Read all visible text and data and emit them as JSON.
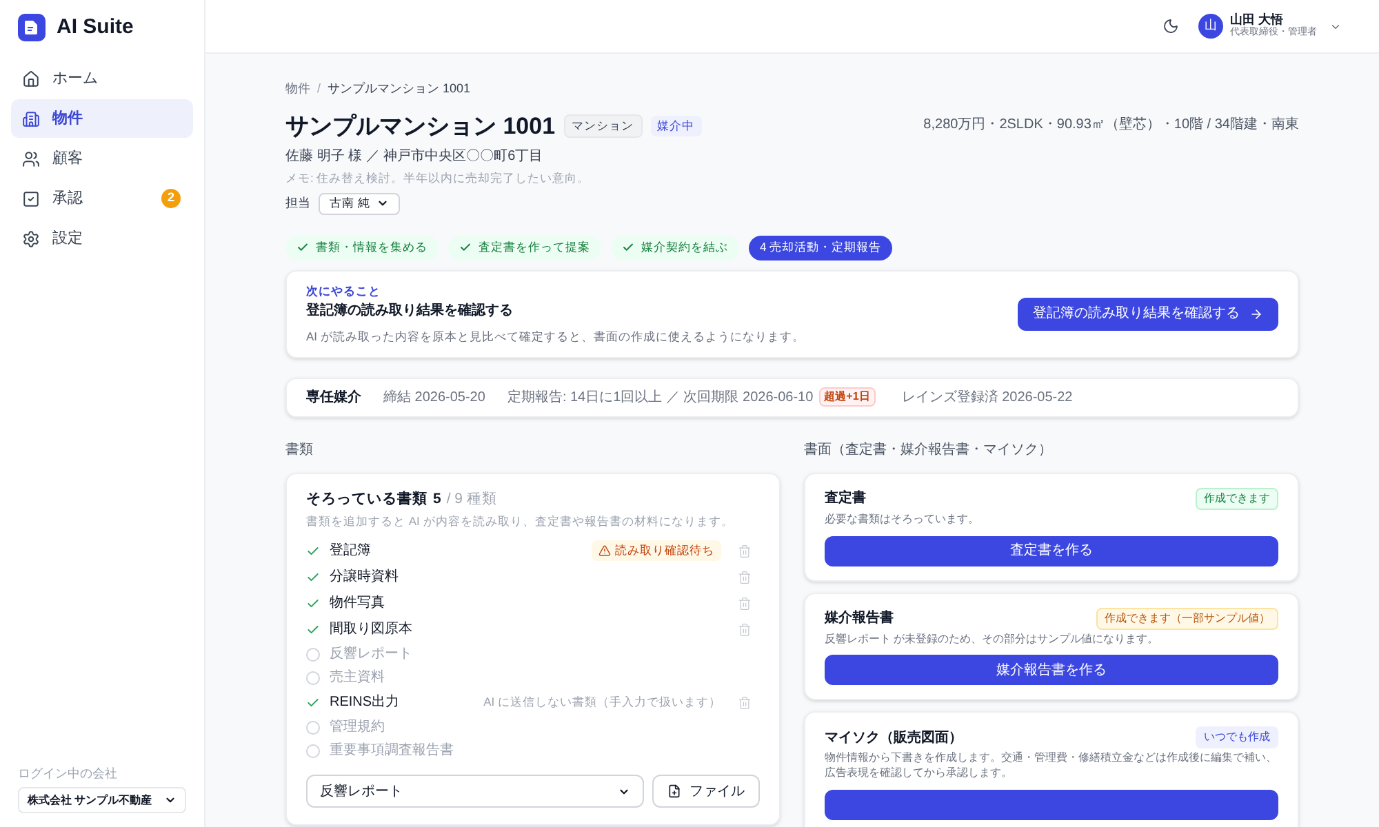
{
  "app": {
    "name": "AI Suite"
  },
  "sidebar": {
    "items": [
      {
        "label": "ホーム",
        "selected": false
      },
      {
        "label": "物件",
        "selected": true
      },
      {
        "label": "顧客",
        "selected": false
      },
      {
        "label": "承認",
        "selected": false,
        "badge": "2"
      },
      {
        "label": "設定",
        "selected": false
      }
    ],
    "company_label": "ログイン中の会社",
    "company": "株式会社 サンプル不動産"
  },
  "header": {
    "user_initial": "山",
    "user_name": "山田 大悟",
    "user_role": "代表取締役・管理者"
  },
  "breadcrumb": {
    "separator": "/",
    "items": [
      "物件",
      "サンプルマンション 1001"
    ]
  },
  "property": {
    "title": "サンプルマンション 1001",
    "tags": [
      {
        "label": "マンション",
        "kind": "neutral"
      },
      {
        "label": "媒介中",
        "kind": "info"
      }
    ],
    "owner_address": "佐藤 明子 様 ／ 神戸市中央区〇〇町6丁目",
    "memo": "メモ: 住み替え検討。半年以内に売却完了したい意向。",
    "summary": "8,280万円・2SLDK・90.93㎡（壁芯）・10階 / 34階建・南東",
    "assignee_label": "担当",
    "assignee": "古南 純"
  },
  "steps": [
    {
      "label": "書類・情報を集める",
      "selected": false
    },
    {
      "label": "査定書を作って提案",
      "selected": false
    },
    {
      "label": "媒介契約を結ぶ",
      "selected": false
    },
    {
      "label": "4 売却活動・定期報告",
      "selected": true
    }
  ],
  "next_action": {
    "eyebrow": "次にやること",
    "title": "登記簿の読み取り結果を確認する",
    "description": "AI が読み取った内容を原本と見比べて確定すると、書面の作成に使えるようになります。",
    "button": "登記簿の読み取り結果を確認する"
  },
  "contract": {
    "type": "専任媒介",
    "signed": "締結 2026-05-20",
    "report": "定期報告: 14日に1回以上 ／ 次回期限 2026-06-10",
    "overdue": "超過+1日",
    "reins": "レインズ登録済 2026-05-22"
  },
  "documents": {
    "heading": "書類",
    "count_label": "そろっている書類",
    "count": "5",
    "total": "/ 9 種類",
    "hint": "書類を追加すると AI が内容を読み取り、査定書や報告書の材料になります。",
    "items": [
      {
        "name": "登記簿",
        "checked": true,
        "note": "読み取り確認待ち",
        "kind": "warning"
      },
      {
        "name": "分譲時資料",
        "checked": true
      },
      {
        "name": "物件写真",
        "checked": true
      },
      {
        "name": "間取り図原本",
        "checked": true
      },
      {
        "name": "反響レポート",
        "checked": false
      },
      {
        "name": "売主資料",
        "checked": false
      },
      {
        "name": "REINS出力",
        "checked": true,
        "note": "AI に送信しない書類（手入力で扱います）",
        "kind": "plain"
      },
      {
        "name": "管理規約",
        "checked": false
      },
      {
        "name": "重要事項調査報告書",
        "checked": false
      }
    ],
    "select_value": "反響レポート",
    "file_button": "ファイル"
  },
  "outputs": {
    "heading": "書面（査定書・媒介報告書・マイソク）",
    "cards": [
      {
        "title": "査定書",
        "status": "作成できます",
        "kind": "ok",
        "description": "必要な書類はそろっています。",
        "button": "査定書を作る"
      },
      {
        "title": "媒介報告書",
        "status": "作成できます（一部サンプル値）",
        "kind": "warn",
        "description": "反響レポート が未登録のため、その部分はサンプル値になります。",
        "button": "媒介報告書を作る"
      },
      {
        "title": "マイソク（販売図面）",
        "status": "いつでも作成",
        "kind": "info",
        "description": "物件情報から下書きを作成します。交通・管理費・修繕積立金などは作成後に編集で補い、広告表現を確認してから承認します。"
      }
    ]
  }
}
